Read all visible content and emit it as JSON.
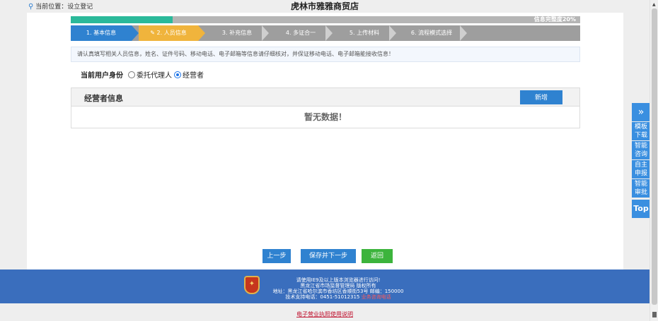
{
  "header": {
    "location_label": "当前位置：设立登记",
    "shop_title": "虎林市雅雅商贸店"
  },
  "progress": {
    "label": "信息完整度20%",
    "percent": 20,
    "fill_color": "#2bb99a"
  },
  "steps": [
    {
      "label": "1. 基本信息",
      "state": "done"
    },
    {
      "label": "2. 人员信息",
      "state": "current"
    },
    {
      "label": "3. 补充信息",
      "state": "todo"
    },
    {
      "label": "4. 多证合一",
      "state": "todo"
    },
    {
      "label": "5. 上传材料",
      "state": "todo"
    },
    {
      "label": "6. 流程模式选择",
      "state": "todo"
    }
  ],
  "notice": "请认真填写相关人员信息，姓名、证件号码、移动电话、电子邮箱等信息请仔细核对，并保证移动电话、电子邮箱能接收信息！",
  "identity": {
    "label": "当前用户身份",
    "options": [
      "委托代理人",
      "经营者"
    ],
    "selected": "经营者"
  },
  "panel": {
    "title": "经营者信息",
    "add_button": "新增",
    "empty_text": "暂无数据！"
  },
  "actions": {
    "prev": "上一步",
    "save_next": "保存并下一步",
    "back": "返回"
  },
  "footer": {
    "line1": "请使用IE9及以上版本浏览器进行访问!",
    "line2": "黑龙江省市场监督管理局 版权所有",
    "line3": "地址：黑龙江省哈尔滨市香坊区香顺街53号 邮编：150000",
    "line4_prefix": "技术支持电话：0451-51012315",
    "line4_red": "业务咨询电话"
  },
  "bottom_link": "电子营业执照使用说明",
  "sidebar": {
    "expand_icon": "double-chevron-right-icon",
    "items": [
      "模板下载",
      "智能咨询",
      "自主申报",
      "智能审批"
    ],
    "top_label": "Top"
  },
  "colors": {
    "primary": "#2f82d0",
    "current_step": "#f0b43c",
    "footer": "#3a6ebd",
    "back_button": "#3cb43c"
  }
}
